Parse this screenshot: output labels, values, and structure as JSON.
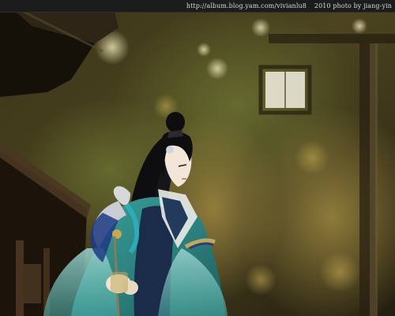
{
  "watermark": {
    "url": "http://album.blog.yam.com/vivianlu8",
    "year_credit": "2010  photo by  jiang-yin"
  },
  "colors": {
    "top_bar": "#1c1c1c",
    "credit_text": "#d8d8d8",
    "foliage_dark": "#2b2616",
    "foliage_warm": "#8a7a3a",
    "robe_teal": "#2f8a86",
    "robe_navy": "#1b2b4a",
    "hair_black": "#0e0e10",
    "skin": "#f1e6d8"
  }
}
